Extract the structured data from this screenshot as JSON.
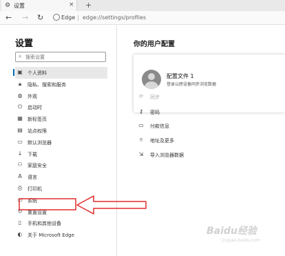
{
  "browser": {
    "tab_title": "设置",
    "tab_close": "×",
    "new_tab": "+",
    "address_origin": "Edge",
    "address_separator": "|",
    "address_url": "edge://settings/profiles"
  },
  "sidebar": {
    "title": "设置",
    "search_placeholder": "搜索设置",
    "items": [
      {
        "label": "个人资料",
        "icon": "person-card-icon",
        "glyph": "▣"
      },
      {
        "label": "隐私、搜索和服务",
        "icon": "lock-icon",
        "glyph": "🔒︎"
      },
      {
        "label": "外观",
        "icon": "palette-icon",
        "glyph": "◍"
      },
      {
        "label": "启动时",
        "icon": "power-icon",
        "glyph": "⏻"
      },
      {
        "label": "新标签页",
        "icon": "new-tab-icon",
        "glyph": "▦"
      },
      {
        "label": "站点权限",
        "icon": "site-permissions-icon",
        "glyph": "▤"
      },
      {
        "label": "默认浏览器",
        "icon": "default-browser-icon",
        "glyph": "▭"
      },
      {
        "label": "下载",
        "icon": "download-icon",
        "glyph": "↓"
      },
      {
        "label": "家庭安全",
        "icon": "family-icon",
        "glyph": "⚇"
      },
      {
        "label": "语言",
        "icon": "language-icon",
        "glyph": "A"
      },
      {
        "label": "打印机",
        "icon": "printer-icon",
        "glyph": "⎙"
      },
      {
        "label": "系统",
        "icon": "system-icon",
        "glyph": "▭"
      },
      {
        "label": "重置设置",
        "icon": "reset-icon",
        "glyph": "↻"
      },
      {
        "label": "手机和其他设备",
        "icon": "phone-icon",
        "glyph": "▯"
      },
      {
        "label": "关于 Microsoft Edge",
        "icon": "edge-logo-icon",
        "glyph": "◐"
      }
    ],
    "active_index": 0
  },
  "main": {
    "title": "你的用户配置",
    "profile": {
      "name": "配置文件 1",
      "description": "登录以跨设备同步浏览数据"
    },
    "options": [
      {
        "label": "同步",
        "icon": "sync-icon",
        "glyph": "⟳",
        "disabled": true
      },
      {
        "label": "密码",
        "icon": "key-icon",
        "glyph": "⚷",
        "disabled": false
      },
      {
        "label": "付款信息",
        "icon": "card-icon",
        "glyph": "▭",
        "disabled": false
      },
      {
        "label": "地址及更多",
        "icon": "location-icon",
        "glyph": "⌾",
        "disabled": false
      },
      {
        "label": "导入浏览器数据",
        "icon": "import-icon",
        "glyph": "⇲",
        "disabled": false
      }
    ]
  },
  "annotation": {
    "color": "#e02b2b"
  },
  "watermark": {
    "text": "Baidu经验",
    "sub": "jingyan.baidu.com"
  }
}
